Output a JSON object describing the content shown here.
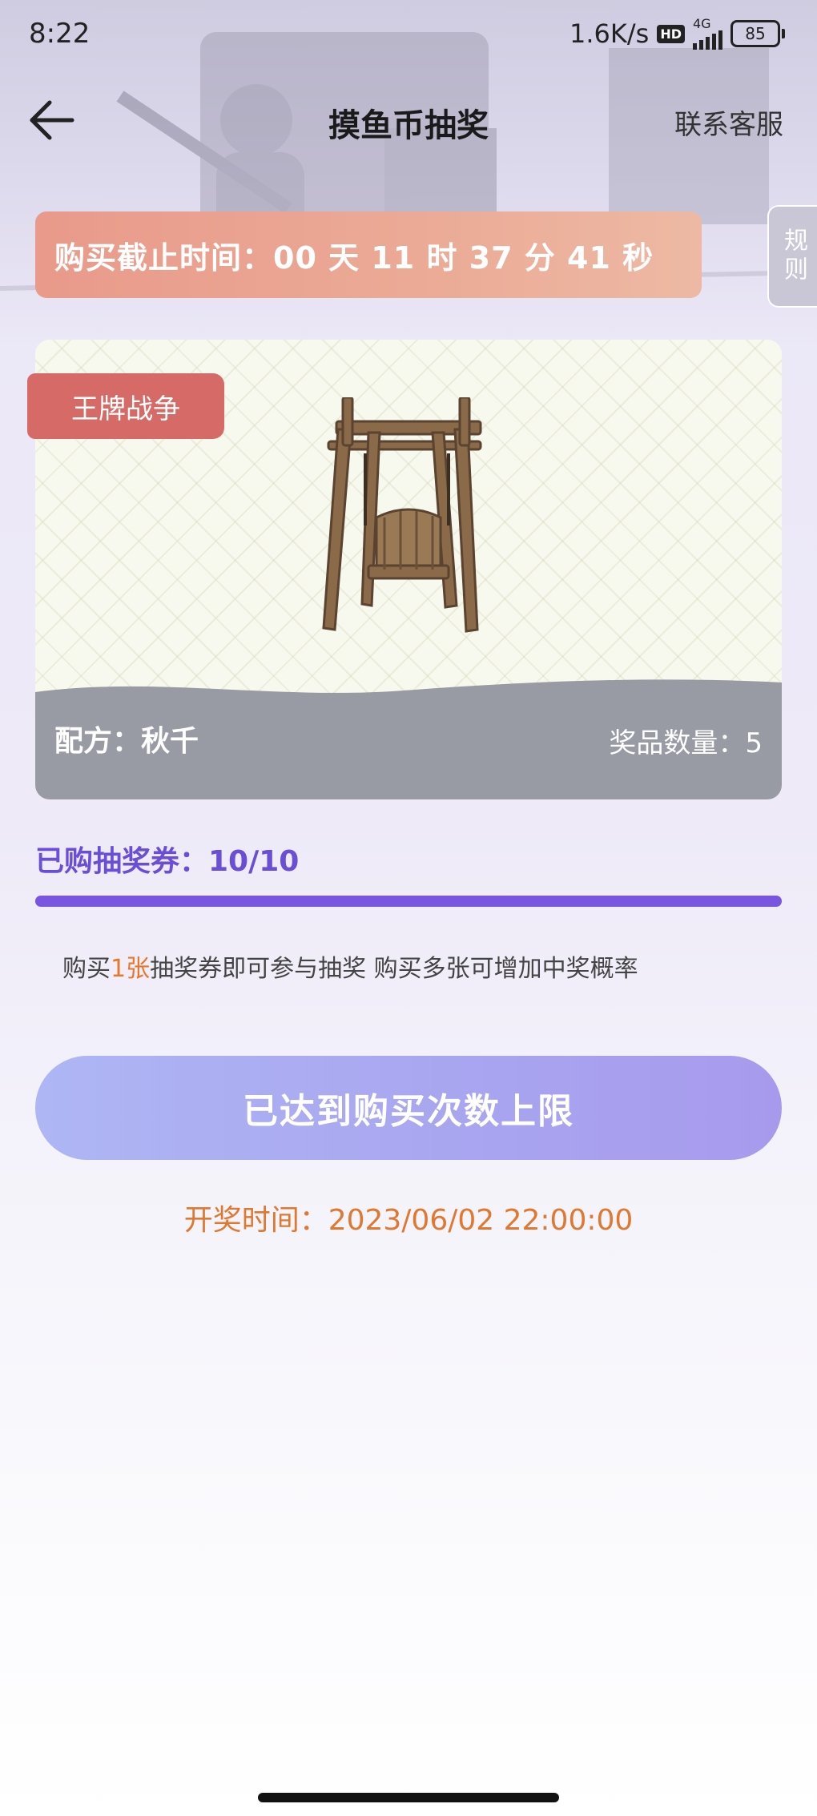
{
  "status_bar": {
    "time": "8:22",
    "net_speed": "1.6K/s",
    "hd": "HD",
    "network": "4G",
    "battery": "85"
  },
  "nav": {
    "back_icon": "arrow-left-icon",
    "title": "摸鱼币抽奖",
    "customer_service": "联系客服"
  },
  "countdown": {
    "text": "购买截止时间：00 天 11 时 37 分 41 秒"
  },
  "rules_tab": {
    "label": "规则"
  },
  "prize": {
    "game_tag": "王牌战争",
    "image_icon": "wooden-swing-icon",
    "formula": "配方：秋千",
    "quantity": "奖品数量：5"
  },
  "tickets": {
    "label": "已购抽奖券：10/10",
    "purchased": 10,
    "total": 10
  },
  "hint": {
    "prefix": "购买",
    "accent": "1张",
    "suffix": "抽奖券即可参与抽奖 购买多张可增加中奖概率"
  },
  "buy_button": {
    "label": "已达到购买次数上限"
  },
  "draw_time": {
    "text": "开奖时间：2023/06/02 22:00:00"
  },
  "colors": {
    "accent_purple": "#7a55e0",
    "accent_orange": "#e8772b",
    "tag_red": "#d56a66",
    "countdown_bg": "#e99a8a"
  }
}
